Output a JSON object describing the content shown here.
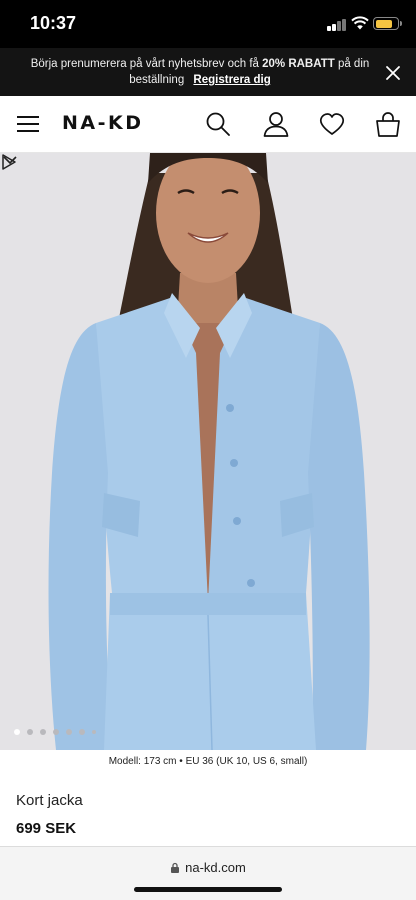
{
  "status_bar": {
    "time": "10:37",
    "battery_level": 0.8
  },
  "promo": {
    "text_before": "Börja prenumerera på vårt nyhetsbrev och få ",
    "highlight": "20% RABATT",
    "text_after": " på din beställning",
    "link": "Registrera dig"
  },
  "header": {
    "logo": "NA-KD",
    "icons": [
      "menu-icon",
      "search-icon",
      "account-icon",
      "wishlist-icon",
      "cart-icon"
    ]
  },
  "gallery": {
    "total_images": 7,
    "active_index": 0
  },
  "product": {
    "model_info": "Modell: 173 cm • EU 36 (UK 10, US 6, small)",
    "name": "Kort jacka",
    "price": "699 SEK"
  },
  "browser": {
    "url": "na-kd.com"
  },
  "colors": {
    "banner_bg": "#141414",
    "jacket_blue": "#a9cbea",
    "photo_bg": "#e4e3e6"
  }
}
